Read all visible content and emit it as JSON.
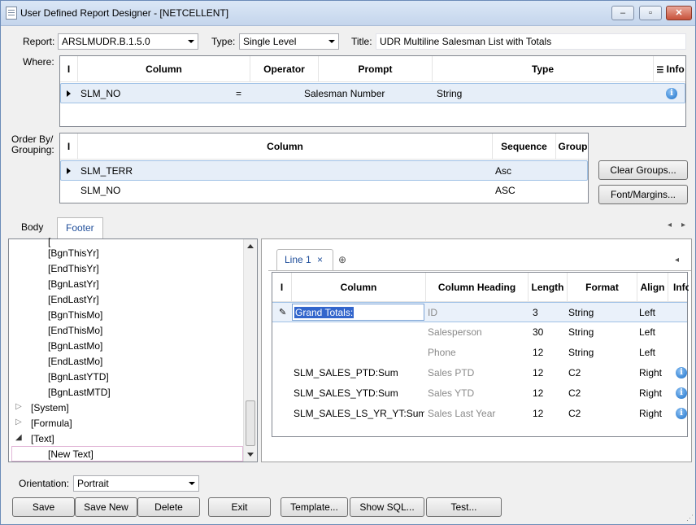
{
  "window": {
    "title": "User Defined Report Designer - [NETCELLENT]"
  },
  "header": {
    "report_label": "Report:",
    "report_value": "ARSLMUDR.B.1.5.0",
    "type_label": "Type:",
    "type_value": "Single Level",
    "title_label": "Title:",
    "title_value": "UDR Multiline Salesman List with Totals"
  },
  "where": {
    "label": "Where:",
    "headers": [
      "Column",
      "Operator",
      "Prompt",
      "Type",
      "Info"
    ],
    "rows": [
      {
        "column": "SLM_NO",
        "operator": "=",
        "prompt": "Salesman Number",
        "type": "String"
      }
    ]
  },
  "order": {
    "label_line1": "Order By/",
    "label_line2": "Grouping:",
    "headers": [
      "Column",
      "Sequence",
      "Group"
    ],
    "rows": [
      {
        "column": "SLM_TERR",
        "sequence": "Asc"
      },
      {
        "column": "SLM_NO",
        "sequence": "ASC"
      }
    ]
  },
  "buttons_side": {
    "clear_groups": "Clear Groups...",
    "font_margins": "Font/Margins..."
  },
  "tabs": {
    "body": "Body",
    "footer": "Footer"
  },
  "tree": {
    "items": [
      "[BgnThisYr]",
      "[EndThisYr]",
      "[BgnLastYr]",
      "[EndLastYr]",
      "[BgnThisMo]",
      "[EndThisMo]",
      "[BgnLastMo]",
      "[EndLastMo]",
      "[BgnLastYTD]",
      "[BgnLastMTD]"
    ],
    "groups": [
      "[System]",
      "[Formula]",
      "[Text]"
    ],
    "new_text": "[New Text]"
  },
  "line_tab": {
    "label": "Line 1",
    "close": "×"
  },
  "footer_grid": {
    "headers": [
      "Column",
      "Column Heading",
      "Length",
      "Format",
      "Align",
      "Info"
    ],
    "rows": [
      {
        "column": "Grand Totals:",
        "heading": "ID",
        "length": "3",
        "format": "String",
        "align": "Left"
      },
      {
        "column": "",
        "heading": "Salesperson",
        "length": "30",
        "format": "String",
        "align": "Left"
      },
      {
        "column": "",
        "heading": "Phone",
        "length": "12",
        "format": "String",
        "align": "Left"
      },
      {
        "column": "SLM_SALES_PTD:Sum",
        "heading": "Sales PTD",
        "length": "12",
        "format": "C2",
        "align": "Right"
      },
      {
        "column": "SLM_SALES_YTD:Sum",
        "heading": "Sales YTD",
        "length": "12",
        "format": "C2",
        "align": "Right"
      },
      {
        "column": "SLM_SALES_LS_YR_YT:Sum",
        "heading": "Sales Last Year",
        "length": "12",
        "format": "C2",
        "align": "Right"
      }
    ]
  },
  "orientation": {
    "label": "Orientation:",
    "value": "Portrait"
  },
  "bottom_buttons": {
    "save": "Save",
    "save_new": "Save New",
    "delete": "Delete",
    "exit": "Exit",
    "template": "Template...",
    "show_sql": "Show SQL...",
    "test": "Test..."
  }
}
